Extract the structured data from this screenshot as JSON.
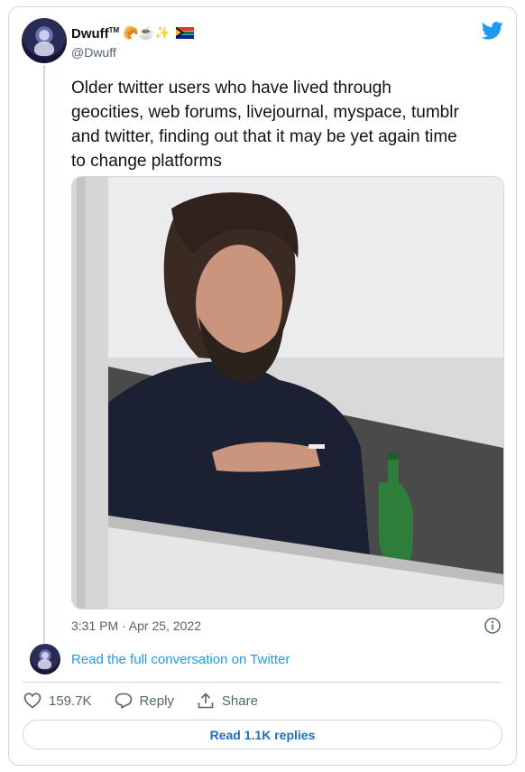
{
  "author": {
    "display_name": "Dwuff",
    "tm": "TM",
    "emojis": "🥐☕✨",
    "handle": "@Dwuff"
  },
  "tweet": {
    "text": "Older twitter users who have lived through\ngeocities, web forums, livejournal, myspace, tumblr\nand twitter, finding out that it may be yet again time\nto change platforms",
    "timestamp": "3:31 PM · Apr 25, 2022"
  },
  "conversation_link": "Read the full conversation on Twitter",
  "actions": {
    "likes": "159.7K",
    "reply": "Reply",
    "share": "Share"
  },
  "read_replies": "Read 1.1K replies",
  "colors": {
    "accent": "#1d9bf0",
    "muted": "#536471",
    "border": "#cfd9de"
  },
  "icons": [
    "twitter-bird-icon",
    "info-icon",
    "heart-icon",
    "reply-icon",
    "share-icon"
  ]
}
